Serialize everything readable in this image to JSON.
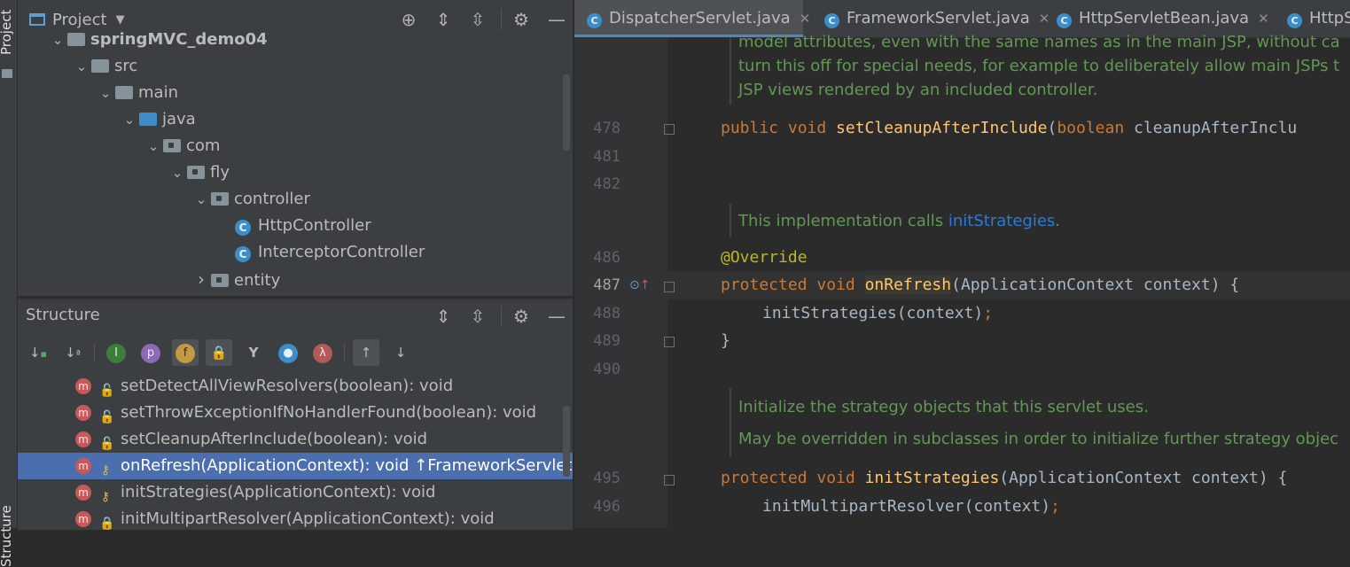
{
  "sidebar_labels": {
    "project": "Project",
    "structure": "Structure"
  },
  "project_panel": {
    "title": "Project",
    "tree": [
      {
        "label": "springMVC_demo04",
        "type": "module",
        "level": 0
      },
      {
        "label": "src",
        "type": "folder",
        "level": 1
      },
      {
        "label": "main",
        "type": "folder",
        "level": 2
      },
      {
        "label": "java",
        "type": "source-folder",
        "level": 3
      },
      {
        "label": "com",
        "type": "package",
        "level": 4
      },
      {
        "label": "fly",
        "type": "package",
        "level": 5
      },
      {
        "label": "controller",
        "type": "package",
        "level": 6
      },
      {
        "label": "HttpController",
        "type": "class",
        "level": 7
      },
      {
        "label": "InterceptorController",
        "type": "class",
        "level": 7
      },
      {
        "label": "entity",
        "type": "package",
        "level": 6
      }
    ]
  },
  "structure_panel": {
    "title": "Structure",
    "toolbar_glyphs": {
      "sort_visibility": "↓",
      "sort_alpha": "↓",
      "inherited": "I",
      "properties": "p",
      "fields": "f",
      "non_public": "🔒",
      "anonymous": "Y",
      "lambdas": "λ",
      "autoscroll_to": "↑",
      "autoscroll_from": "↓"
    },
    "members": [
      {
        "label": "setDetectAllViewResolvers(boolean): void",
        "access": "public",
        "selected": false
      },
      {
        "label": "setThrowExceptionIfNoHandlerFound(boolean): void",
        "access": "public",
        "selected": false
      },
      {
        "label": "setCleanupAfterInclude(boolean): void",
        "access": "public",
        "selected": false
      },
      {
        "label": "onRefresh(ApplicationContext): void ↑FrameworkServlet",
        "access": "protected",
        "selected": true
      },
      {
        "label": "initStrategies(ApplicationContext): void",
        "access": "protected",
        "selected": false
      },
      {
        "label": "initMultipartResolver(ApplicationContext): void",
        "access": "private",
        "selected": false
      }
    ]
  },
  "editor": {
    "tabs": [
      {
        "label": "DispatcherServlet.java",
        "active": true
      },
      {
        "label": "FrameworkServlet.java",
        "active": false
      },
      {
        "label": "HttpServletBean.java",
        "active": false
      },
      {
        "label": "HttpS",
        "active": false
      }
    ],
    "doc_lines_top": [
      "model attributes, even with the same names as in the main JSP, without ca",
      "turn this off for special needs, for example to deliberately allow main JSPs t",
      "JSP views rendered by an included controller."
    ],
    "line_numbers": [
      "478",
      "481",
      "482",
      "486",
      "487",
      "488",
      "489",
      "490",
      "495",
      "496"
    ],
    "line_478": {
      "kw": "public void ",
      "fn": "setCleanupAfterInclude",
      "rest1": "(",
      "kw2": "boolean",
      "rest2": " cleanupAfterInclu"
    },
    "doc_init_prefix": "This implementation calls ",
    "doc_init_link": "initStrategies",
    "doc_init_suffix": ".",
    "annotation": "@Override",
    "line_487": {
      "kw": "protected void ",
      "fn": "onRefresh",
      "rest": "(ApplicationContext context) {"
    },
    "line_488": {
      "code": "initStrategies(context)",
      "semi": ";"
    },
    "line_489": "}",
    "doc_bottom": [
      "Initialize the strategy objects that this servlet uses.",
      "May be overridden in subclasses in order to initialize further strategy objec"
    ],
    "line_495": {
      "kw": "protected void ",
      "fn": "initStrategies",
      "rest": "(ApplicationContext context) {"
    },
    "line_496": {
      "code": "initMultipartResolver(context)",
      "semi": ";"
    }
  },
  "colors": {
    "selection": "#4b6eaf",
    "keyword": "#cc7832",
    "function": "#ffc66d",
    "doc": "#629755",
    "annotation": "#bbb529",
    "link": "#287bde"
  }
}
